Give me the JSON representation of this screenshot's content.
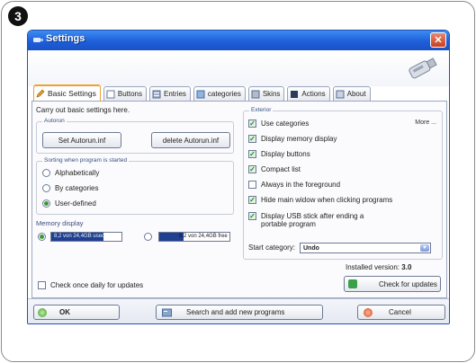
{
  "step_badge": "3",
  "window": {
    "title": "Settings",
    "close_label": "✕"
  },
  "tabs": [
    {
      "label": "Basic Settings",
      "active": true
    },
    {
      "label": "Buttons"
    },
    {
      "label": "Entries"
    },
    {
      "label": "categories"
    },
    {
      "label": "Skins"
    },
    {
      "label": "Actions"
    },
    {
      "label": "About"
    }
  ],
  "panel": {
    "intro": "Carry out basic settings here.",
    "autorun": {
      "title": "Autorun",
      "set_button": "Set Autorun.inf",
      "delete_button": "delete Autorun.inf"
    },
    "sorting": {
      "title": "Sorting when program is started",
      "options": [
        {
          "label": "Alphabetically",
          "selected": false
        },
        {
          "label": "By categories",
          "selected": false
        },
        {
          "label": "User-defined",
          "selected": true
        }
      ]
    },
    "memory": {
      "title": "Memory display",
      "used": {
        "text": "8,2 von 24,4GB used",
        "selected": true,
        "fraction": 0.34
      },
      "free": {
        "text": "8,2 von 24,4GB free",
        "selected": false,
        "fraction": 0.34
      }
    },
    "exterior": {
      "title": "Exterior",
      "more_link": "More ...",
      "options": [
        {
          "label": "Use categories",
          "checked": true
        },
        {
          "label": "Display memory display",
          "checked": true
        },
        {
          "label": "Display buttons",
          "checked": true
        },
        {
          "label": "Compact list",
          "checked": true
        },
        {
          "label": "Always in the foreground",
          "checked": false
        },
        {
          "label": "Hide main widow when clicking programs",
          "checked": true
        },
        {
          "label": "Display USB stick after ending a portable program",
          "checked": true
        }
      ],
      "start_category_label": "Start category:",
      "start_category_value": "Undo"
    },
    "updates": {
      "daily_label": "Check once daily for updates",
      "daily_checked": false,
      "installed_label": "Installed version:",
      "installed_value": "3.0",
      "check_button": "Check for updates"
    }
  },
  "bottom": {
    "ok": "OK",
    "search": "Search and add new programs",
    "cancel": "Cancel"
  },
  "colors": {
    "titlebar": "#1e5fd9",
    "accent_tab": "#f0a030",
    "check_green": "#1f8a1f",
    "memory_fill": "#1f3f8f"
  }
}
